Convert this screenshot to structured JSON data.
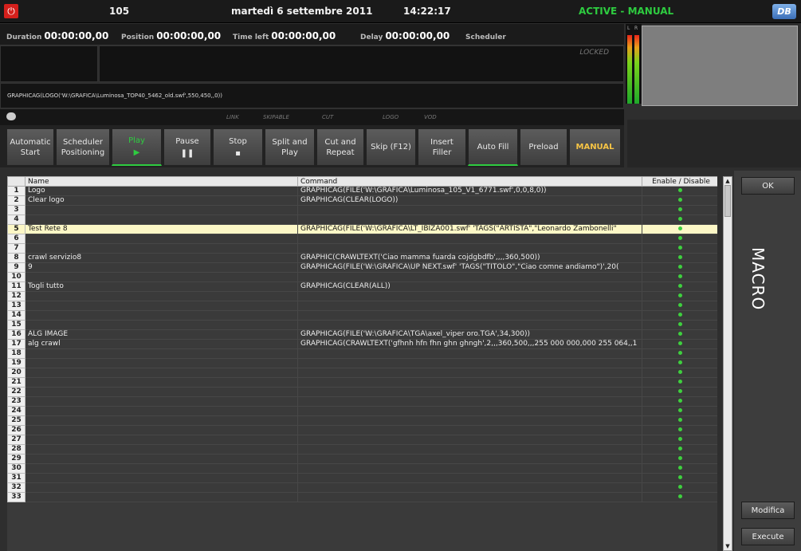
{
  "topbar": {
    "power_label": "⏻",
    "channel": "105",
    "date": "martedì 6 settembre 2011",
    "time": "14:22:17",
    "status": "ACTIVE - MANUAL",
    "logo_text": "DB"
  },
  "info": {
    "duration_label": "Duration",
    "duration": "00:00:00,00",
    "position_label": "Position",
    "position": "00:00:00,00",
    "timeleft_label": "Time left",
    "timeleft": "00:00:00,00",
    "delay_label": "Delay",
    "delay": "00:00:00,00",
    "scheduler_label": "Scheduler"
  },
  "locked": "LOCKED",
  "current_command": "GRAPHICAG(LOGO('W:\\GRAFICA\\Luminosa_TOP40_5462_old.swf',550,450,,0))",
  "flags": {
    "link": "LINK",
    "skipable": "SKIPABLE",
    "cut": "CUT",
    "logo": "LOGO",
    "vod": "VOD"
  },
  "meter": {
    "l": "L",
    "r": "R"
  },
  "buttons": [
    {
      "l1": "Automatic",
      "l2": "Start"
    },
    {
      "l1": "Scheduler",
      "l2": "Positioning"
    },
    {
      "l1": "Play",
      "l2": "▶"
    },
    {
      "l1": "Pause",
      "l2": "❚❚"
    },
    {
      "l1": "Stop",
      "l2": "▪"
    },
    {
      "l1": "Split and",
      "l2": "Play"
    },
    {
      "l1": "Cut and",
      "l2": "Repeat"
    },
    {
      "l1": "Skip (F12)",
      "l2": ""
    },
    {
      "l1": "Insert",
      "l2": "Filler"
    },
    {
      "l1": "Auto Fill",
      "l2": ""
    },
    {
      "l1": "Preload",
      "l2": ""
    },
    {
      "l1": "MANUAL",
      "l2": ""
    }
  ],
  "table": {
    "headers": [
      "",
      "Name",
      "Command",
      "Enable / Disable"
    ],
    "rows": [
      {
        "n": "1",
        "name": "Logo",
        "cmd": "GRAPHICAG(FILE('W:\\GRAFICA\\Luminosa_105_V1_6771.swf',0,0,8,0))"
      },
      {
        "n": "2",
        "name": "Clear logo",
        "cmd": "GRAPHICAG(CLEAR(LOGO))"
      },
      {
        "n": "3",
        "name": "",
        "cmd": ""
      },
      {
        "n": "4",
        "name": "",
        "cmd": ""
      },
      {
        "n": "5",
        "name": "Test Rete 8",
        "cmd": "GRAPHICAG(FILE('W:\\GRAFICA\\LT_IBIZA001.swf' 'TAGS(\"ARTISTA\",\"Leonardo Zambonelli\""
      },
      {
        "n": "6",
        "name": "",
        "cmd": ""
      },
      {
        "n": "7",
        "name": "",
        "cmd": ""
      },
      {
        "n": "8",
        "name": "crawl servizio8",
        "cmd": "GRAPHIC(CRAWLTEXT('Ciao mamma fuarda cojdgbdfb',,,,360,500))"
      },
      {
        "n": "9",
        "name": "9",
        "cmd": "GRAPHICAG(FILE('W:\\GRAFICA\\UP NEXT.swf' 'TAGS(\"TITOLO\",\"Ciao comne andiamo\")',20("
      },
      {
        "n": "10",
        "name": "",
        "cmd": ""
      },
      {
        "n": "11",
        "name": "Togli tutto",
        "cmd": "GRAPHICAG(CLEAR(ALL))"
      },
      {
        "n": "12",
        "name": "",
        "cmd": ""
      },
      {
        "n": "13",
        "name": "",
        "cmd": ""
      },
      {
        "n": "14",
        "name": "",
        "cmd": ""
      },
      {
        "n": "15",
        "name": "",
        "cmd": ""
      },
      {
        "n": "16",
        "name": "ALG IMAGE",
        "cmd": "GRAPHICAG(FILE('W:\\GRAFICA\\TGA\\axel_viper oro.TGA',34,300))"
      },
      {
        "n": "17",
        "name": "alg crawl",
        "cmd": "GRAPHICAG(CRAWLTEXT('gfhnh hfn fhn ghn ghngh',2,,,360,500,,,255 000 000,000 255 064,,1"
      },
      {
        "n": "18",
        "name": "",
        "cmd": ""
      },
      {
        "n": "19",
        "name": "",
        "cmd": ""
      },
      {
        "n": "20",
        "name": "",
        "cmd": ""
      },
      {
        "n": "21",
        "name": "",
        "cmd": ""
      },
      {
        "n": "22",
        "name": "",
        "cmd": ""
      },
      {
        "n": "23",
        "name": "",
        "cmd": ""
      },
      {
        "n": "24",
        "name": "",
        "cmd": ""
      },
      {
        "n": "25",
        "name": "",
        "cmd": ""
      },
      {
        "n": "26",
        "name": "",
        "cmd": ""
      },
      {
        "n": "27",
        "name": "",
        "cmd": ""
      },
      {
        "n": "28",
        "name": "",
        "cmd": ""
      },
      {
        "n": "29",
        "name": "",
        "cmd": ""
      },
      {
        "n": "30",
        "name": "",
        "cmd": ""
      },
      {
        "n": "31",
        "name": "",
        "cmd": ""
      },
      {
        "n": "32",
        "name": "",
        "cmd": ""
      },
      {
        "n": "33",
        "name": "",
        "cmd": ""
      }
    ],
    "selected_row": "5"
  },
  "side": {
    "ok": "OK",
    "macro": "MACRO",
    "modifica": "Modifica",
    "execute": "Execute"
  },
  "colors": {
    "status": "#2ecc40",
    "selected_row": "#fcf7c6",
    "enabled_dot": "#3ecf3e"
  }
}
